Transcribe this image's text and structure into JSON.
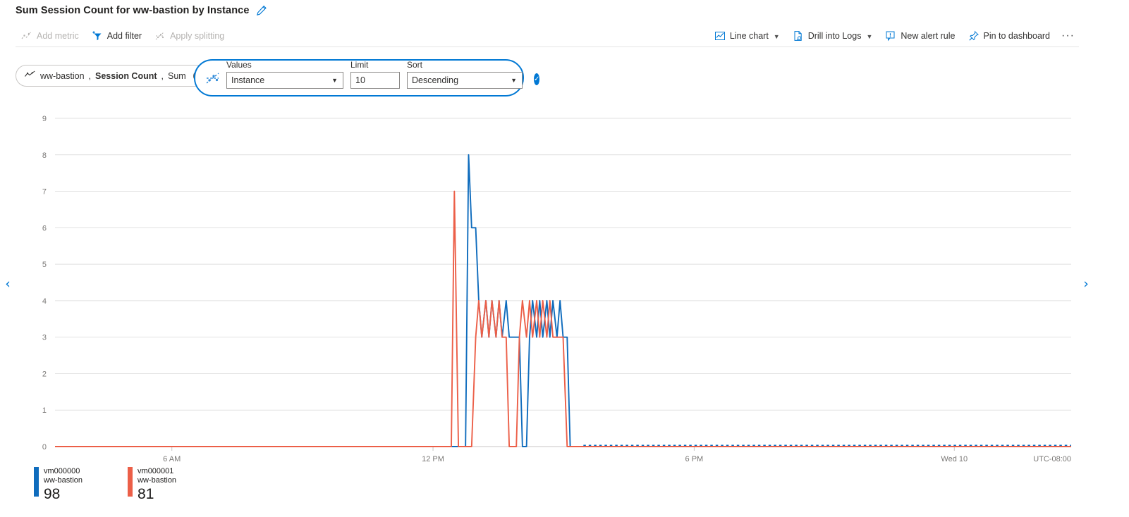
{
  "header": {
    "title": "Sum Session Count for ww-bastion by Instance",
    "edit_icon": "pencil-icon"
  },
  "toolbar": {
    "left": [
      {
        "label": "Add metric",
        "icon": "add-metric-icon",
        "disabled": true
      },
      {
        "label": "Add filter",
        "icon": "add-filter-icon",
        "disabled": false
      },
      {
        "label": "Apply splitting",
        "icon": "apply-splitting-icon",
        "disabled": true
      }
    ],
    "right": [
      {
        "label": "Line chart",
        "icon": "line-chart-icon",
        "chevron": true
      },
      {
        "label": "Drill into Logs",
        "icon": "drill-logs-icon",
        "chevron": true
      },
      {
        "label": "New alert rule",
        "icon": "alert-rule-icon",
        "chevron": false
      },
      {
        "label": "Pin to dashboard",
        "icon": "pin-icon",
        "chevron": false
      }
    ],
    "overflow_label": "···"
  },
  "metric_chip": {
    "icon": "metric-line-icon",
    "resource": "ww-bastion",
    "metric": "Session Count",
    "aggregation": "Sum",
    "separator": ", ",
    "remove_label": "✕"
  },
  "splitting": {
    "icon": "splitting-icon",
    "values": {
      "label": "Values",
      "selected": "Instance"
    },
    "limit": {
      "label": "Limit",
      "value": "10"
    },
    "sort": {
      "label": "Sort",
      "selected": "Descending"
    },
    "confirm_label": "✓"
  },
  "navigation": {
    "prev_label": "‹",
    "next_label": "›"
  },
  "legend": [
    {
      "name": "vm000000",
      "resource": "ww-bastion",
      "value": "98",
      "color": "#0f6cbd"
    },
    {
      "name": "vm000001",
      "resource": "ww-bastion",
      "value": "81",
      "color": "#ec5f48"
    }
  ],
  "chart_data": {
    "type": "line",
    "title": "Sum Session Count for ww-bastion by Instance",
    "xlabel": "",
    "ylabel": "",
    "ylim": [
      0,
      9
    ],
    "yticks": [
      0,
      1,
      2,
      3,
      4,
      5,
      6,
      7,
      8,
      9
    ],
    "xticks": [
      "6 AM",
      "12 PM",
      "6 PM",
      "Wed 10"
    ],
    "xtick_positions": [
      0.115,
      0.372,
      0.629,
      0.885
    ],
    "timezone_label": "UTC-08:00",
    "grid": true,
    "legend_position": "bottom-left",
    "series": [
      {
        "name": "vm000000",
        "resource": "ww-bastion",
        "color": "#0f6cbd",
        "aggregate_value": 98,
        "x": [
          0.0,
          0.4,
          0.404,
          0.407,
          0.41,
          0.414,
          0.417,
          0.42,
          0.424,
          0.427,
          0.43,
          0.434,
          0.437,
          0.44,
          0.444,
          0.447,
          0.45,
          0.454,
          0.457,
          0.46,
          0.464,
          0.467,
          0.47,
          0.474,
          0.477,
          0.48,
          0.484,
          0.487,
          0.49,
          0.494,
          0.497,
          0.5,
          0.504,
          0.507,
          0.51,
          0.514,
          1.0
        ],
        "y": [
          0,
          0,
          0,
          8,
          6,
          6,
          4,
          3,
          4,
          3,
          4,
          3,
          4,
          3,
          4,
          3,
          3,
          3,
          3,
          0,
          0,
          3,
          4,
          3,
          4,
          3,
          4,
          3,
          4,
          3,
          4,
          3,
          3,
          0,
          0,
          0,
          0
        ]
      },
      {
        "name": "vm000001",
        "resource": "ww-bastion",
        "color": "#ec5f48",
        "aggregate_value": 81,
        "x": [
          0.0,
          0.39,
          0.393,
          0.397,
          0.4,
          0.404,
          0.407,
          0.41,
          0.414,
          0.417,
          0.42,
          0.424,
          0.427,
          0.43,
          0.434,
          0.437,
          0.44,
          0.444,
          0.447,
          0.45,
          0.454,
          0.457,
          0.46,
          0.464,
          0.467,
          0.47,
          0.474,
          0.477,
          0.48,
          0.484,
          0.487,
          0.49,
          0.494,
          0.497,
          0.5,
          0.504,
          0.507,
          0.51,
          0.514,
          1.0
        ],
        "y": [
          0,
          0,
          7,
          0,
          0,
          0,
          0,
          0,
          3,
          4,
          3,
          4,
          3,
          4,
          3,
          4,
          3,
          3,
          0,
          0,
          0,
          3,
          4,
          3,
          4,
          3,
          4,
          3,
          4,
          3,
          4,
          3,
          3,
          3,
          3,
          0,
          0,
          0,
          0,
          0
        ]
      }
    ],
    "nodata_dotted_from": 0.52
  },
  "colors": {
    "accent": "#0078d4",
    "series_blue": "#0f6cbd",
    "series_red": "#ec5f48",
    "grid": "#e1e1e1",
    "axis_text": "#797775"
  }
}
